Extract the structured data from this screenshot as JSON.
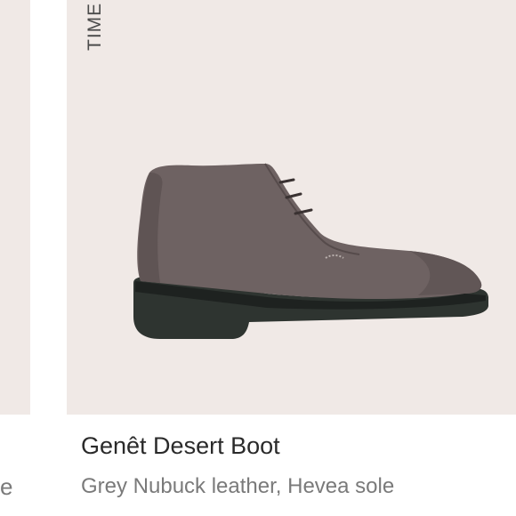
{
  "left_card": {
    "description_fragment": "e"
  },
  "main_card": {
    "vertical_label": "TIME",
    "product_image": "grey-desert-boot-image",
    "title": "Genêt Desert Boot",
    "description": "Grey Nubuck leather, Hevea sole"
  },
  "colors": {
    "image_background": "#f0e9e6",
    "boot_upper": "#6e6262",
    "boot_sole": "#2e3430",
    "title_text": "#2a2a2a",
    "description_text": "#7a7a7a"
  }
}
